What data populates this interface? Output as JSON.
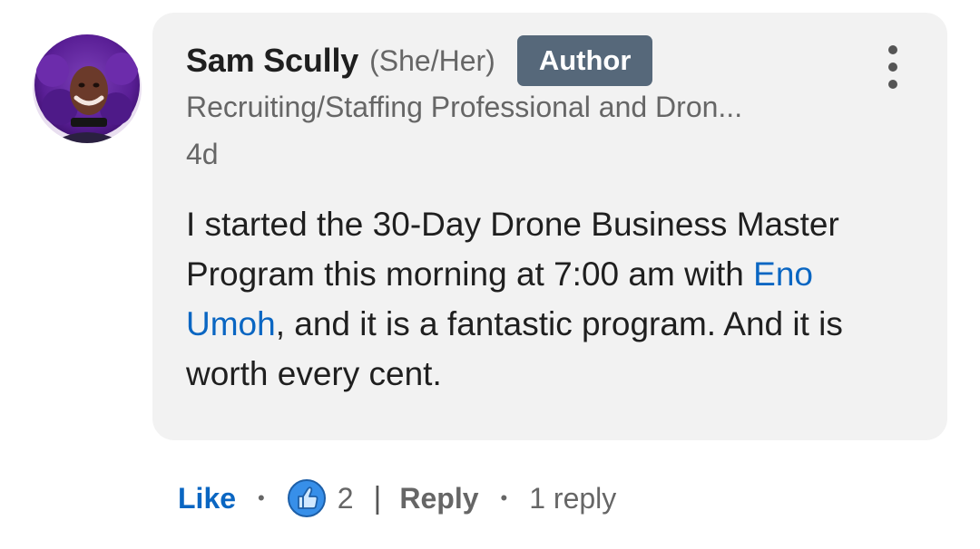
{
  "comment": {
    "author_name": "Sam Scully",
    "pronouns": "(She/Her)",
    "badge": "Author",
    "headline": "Recruiting/Staffing Professional and Dron...",
    "timestamp": "4d",
    "text_part1": "I started the 30-Day Drone Business Master Program this morning at 7:00 am with ",
    "mention": "Eno Umoh",
    "text_part2": ", and it is a fantastic program. And it is worth every cent.",
    "more_icon": "three-dots-vertical-icon"
  },
  "actions": {
    "like_label": "Like",
    "separator_dot": "•",
    "reaction_icon": "thumbs-up-icon",
    "reaction_count": "2",
    "separator_bar": "|",
    "reply_label": "Reply",
    "reply_count": "1 reply"
  },
  "colors": {
    "link_blue": "#0a66c2",
    "badge_bg": "#56687a",
    "bubble_bg": "#f2f2f2",
    "muted_text": "#666666",
    "primary_text": "#1f1f1f"
  }
}
